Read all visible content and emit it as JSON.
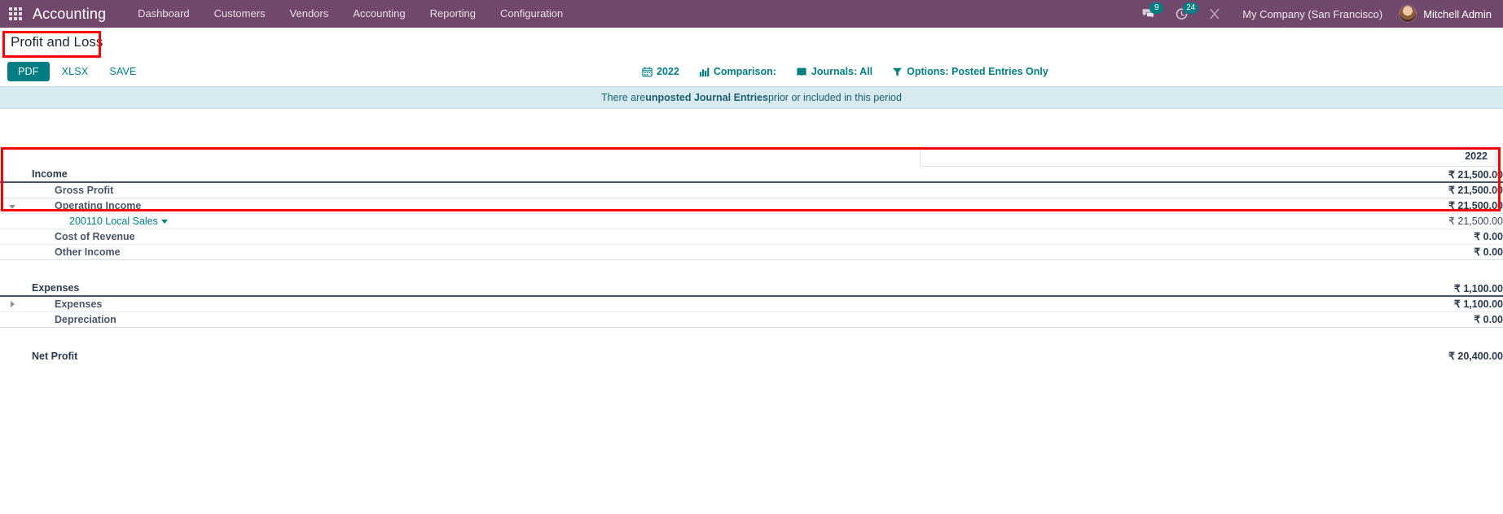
{
  "navbar": {
    "apps_icon": "apps-grid-icon",
    "brand": "Accounting",
    "menu": [
      {
        "label": "Dashboard"
      },
      {
        "label": "Customers"
      },
      {
        "label": "Vendors"
      },
      {
        "label": "Accounting"
      },
      {
        "label": "Reporting"
      },
      {
        "label": "Configuration"
      }
    ],
    "messages": {
      "icon": "chat-bubble-icon",
      "count": "9"
    },
    "activities": {
      "icon": "clock-activity-icon",
      "count": "24"
    },
    "debug": {
      "icon": "wrench-tools-icon"
    },
    "company": "My Company (San Francisco)",
    "user": {
      "name": "Mitchell Admin",
      "avatar": "user-avatar"
    }
  },
  "control_panel": {
    "title": "Profit and Loss",
    "buttons": {
      "pdf": "PDF",
      "xlsx": "XLSX",
      "save": "SAVE"
    },
    "filters": [
      {
        "icon": "calendar-icon",
        "label": "2022",
        "name": "date-filter"
      },
      {
        "icon": "bar-chart-icon",
        "label": "Comparison:",
        "name": "comparison-filter"
      },
      {
        "icon": "book-icon",
        "label": "Journals: All",
        "name": "journals-filter"
      },
      {
        "icon": "funnel-icon",
        "label": "Options: Posted Entries Only",
        "name": "options-filter"
      }
    ]
  },
  "banner": {
    "prefix": "There are ",
    "strong": "unposted Journal Entries",
    "suffix": " prior or included in this period"
  },
  "report": {
    "column_header": "2022",
    "rows": [
      {
        "name": "Income",
        "value": "₹ 21,500.00",
        "level": 0,
        "toggle": "none",
        "border": "double",
        "link": false
      },
      {
        "name": "Gross Profit",
        "value": "₹ 21,500.00",
        "level": 1,
        "toggle": "none",
        "border": "thin",
        "link": false
      },
      {
        "name": "Operating Income",
        "value": "₹ 21,500.00",
        "level": 1,
        "toggle": "down",
        "border": "faint",
        "link": false
      },
      {
        "name": "200110 Local Sales",
        "value": "₹ 21,500.00",
        "level": 2,
        "toggle": "none",
        "border": "faint",
        "link": true
      },
      {
        "name": "Cost of Revenue",
        "value": "₹ 0.00",
        "level": 1,
        "toggle": "none",
        "border": "faint",
        "link": false
      },
      {
        "name": "Other Income",
        "value": "₹ 0.00",
        "level": 1,
        "toggle": "none",
        "border": "thin",
        "link": false
      }
    ],
    "expense_rows": [
      {
        "name": "Expenses",
        "value": "₹ 1,100.00",
        "level": 0,
        "toggle": "none",
        "border": "double",
        "link": false
      },
      {
        "name": "Expenses",
        "value": "₹ 1,100.00",
        "level": 1,
        "toggle": "right",
        "border": "faint",
        "link": false
      },
      {
        "name": "Depreciation",
        "value": "₹ 0.00",
        "level": 1,
        "toggle": "none",
        "border": "thin",
        "link": false
      }
    ],
    "total_rows": [
      {
        "name": "Net Profit",
        "value": "₹ 20,400.00",
        "level": 0,
        "toggle": "none",
        "border": "none",
        "link": false
      }
    ]
  },
  "annotations": {
    "title_box_color": "#fe0000",
    "income_box_color": "#fe0000"
  }
}
